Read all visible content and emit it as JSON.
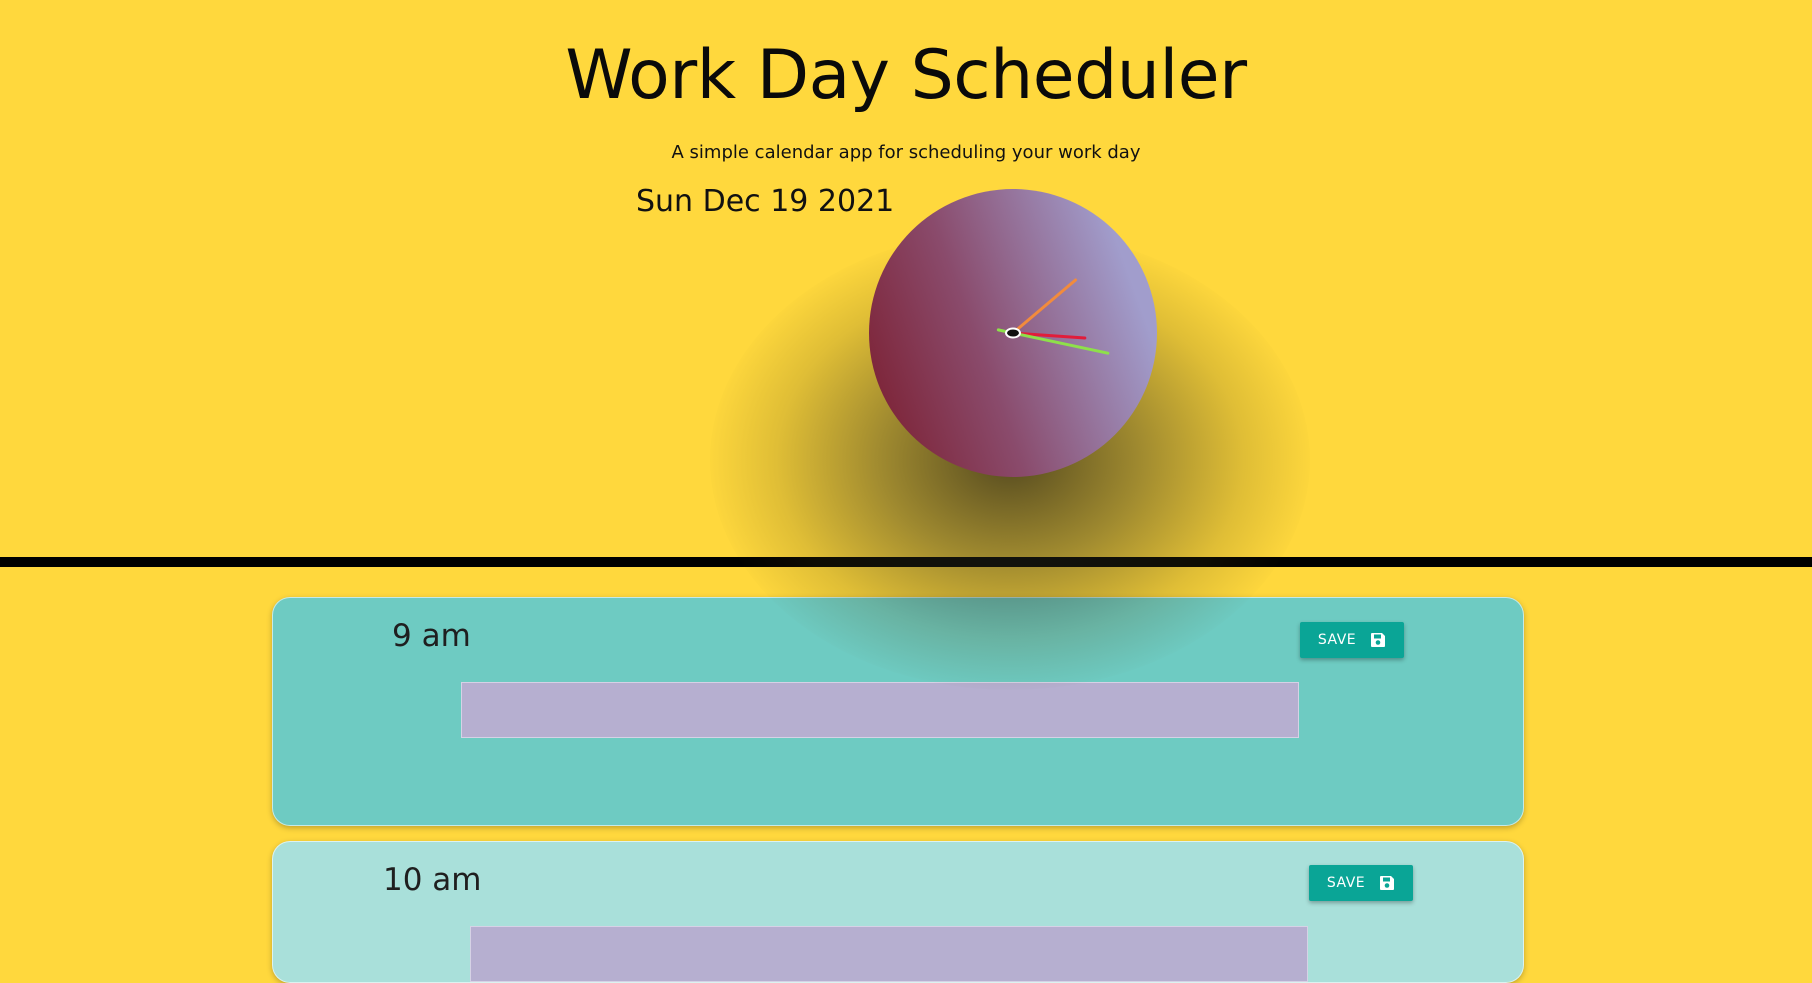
{
  "header": {
    "title": "Work Day Scheduler",
    "subtitle": "A simple calendar app for scheduling your work day",
    "current_date": "Sun Dec 19 2021"
  },
  "clock": {
    "face_colors": [
      "#7a1a2a",
      "#a19dcc"
    ],
    "hand_colors": {
      "hour": "#e11d3a",
      "minute": "#f28b3c",
      "second": "#8ee04a"
    },
    "time_shown": {
      "hour": 3,
      "minute": 8,
      "second": 17
    }
  },
  "colors": {
    "background": "#ffd83d",
    "divider": "#000000",
    "current_hour_row": "#6ecbc2",
    "future_hour_row": "#a9e0da",
    "save_button": "#0aa596",
    "input_background": "#b6afd0"
  },
  "schedule": {
    "rows": [
      {
        "hour_label": "9 am",
        "save_label": "SAVE",
        "task_value": "",
        "save_icon": "floppy-disk-icon"
      },
      {
        "hour_label": "10 am",
        "save_label": "SAVE",
        "task_value": "",
        "save_icon": "floppy-disk-icon"
      }
    ]
  }
}
